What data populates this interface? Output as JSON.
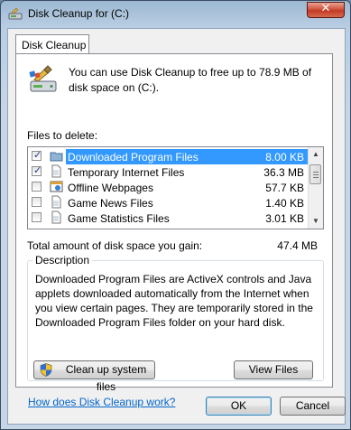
{
  "window": {
    "title": "Disk Cleanup for  (C:)",
    "close_glyph": "✕"
  },
  "tab": {
    "label": "Disk Cleanup"
  },
  "intro": {
    "text": "You can use Disk Cleanup to free up to 78.9 MB of disk space on  (C:)."
  },
  "files_label": "Files to delete:",
  "files": [
    {
      "name": "Downloaded Program Files",
      "size": "8.00 KB",
      "checked": true,
      "selected": true,
      "icon": "folder-icon"
    },
    {
      "name": "Temporary Internet Files",
      "size": "36.3 MB",
      "checked": true,
      "selected": false,
      "icon": "document-icon"
    },
    {
      "name": "Offline Webpages",
      "size": "57.7 KB",
      "checked": false,
      "selected": false,
      "icon": "webpage-icon"
    },
    {
      "name": "Game News Files",
      "size": "1.40 KB",
      "checked": false,
      "selected": false,
      "icon": "document-icon"
    },
    {
      "name": "Game Statistics Files",
      "size": "3.01 KB",
      "checked": false,
      "selected": false,
      "icon": "document-icon"
    }
  ],
  "total": {
    "label": "Total amount of disk space you gain:",
    "value": "47.4 MB"
  },
  "description": {
    "title": "Description",
    "text": "Downloaded Program Files are ActiveX controls and Java applets downloaded automatically from the Internet when you view certain pages. They are temporarily stored in the Downloaded Program Files folder on your hard disk."
  },
  "buttons": {
    "cleanup_system": "Clean up system files",
    "view_files": "View Files",
    "ok": "OK",
    "cancel": "Cancel"
  },
  "link": {
    "text": "How does Disk Cleanup work?"
  },
  "colors": {
    "selection": "#3399ff",
    "link": "#0066cc",
    "accent": "#3c7fb1"
  }
}
